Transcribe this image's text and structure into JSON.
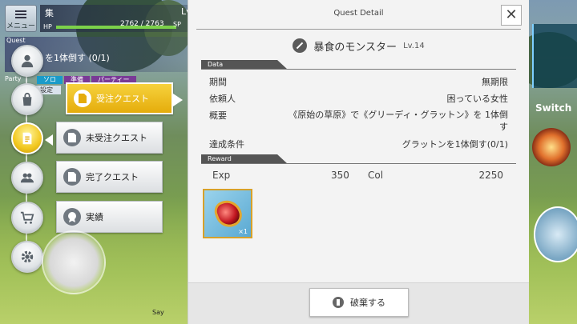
{
  "hud": {
    "menu_label": "メニュー",
    "player_name": "集",
    "level_label": "Lv",
    "hp_label": "HP",
    "hp_text": "2762 / 2763",
    "hp_fraction": 0.9996,
    "sp_label": "SP",
    "quest_tracker_header": "Quest",
    "quest_tracker_text": "を1体倒す (0/1)",
    "party_label": "Party",
    "party_tabs": [
      "ソロ",
      "準備",
      "パーティー"
    ],
    "party_sub": "設定",
    "say_label": "Say"
  },
  "side_menu": {
    "items": [
      {
        "label": "受注クエスト",
        "icon": "document-icon",
        "active": true
      },
      {
        "label": "未受注クエスト",
        "icon": "quest-list-icon",
        "active": false
      },
      {
        "label": "完了クエスト",
        "icon": "completed-list-icon",
        "active": false
      },
      {
        "label": "実績",
        "icon": "medal-icon",
        "active": false
      }
    ]
  },
  "right_hud": {
    "switch_label": "Switch"
  },
  "dialog": {
    "title": "Quest Detail",
    "quest_name": "暴食のモンスター",
    "quest_level": "Lv.14",
    "data_section": "Data",
    "rows": [
      {
        "key": "期間",
        "value": "無期限"
      },
      {
        "key": "依頼人",
        "value": "困っている女性"
      },
      {
        "key": "概要",
        "value": "《原始の草原》で《グリーディ・グラットン》を 1体倒す"
      },
      {
        "key": "達成条件",
        "value": "グラットンを1体倒す(0/1)"
      }
    ],
    "reward_section": "Reward",
    "reward": {
      "exp_label": "Exp",
      "exp_value": "350",
      "col_label": "Col",
      "col_value": "2250"
    },
    "item_qty": "×1",
    "discard_label": "破棄する"
  },
  "colors": {
    "active_menu": "#f2c81f",
    "hp_bar": "#7cd14a",
    "section_bar": "#555555",
    "item_border": "#d7a12a"
  }
}
